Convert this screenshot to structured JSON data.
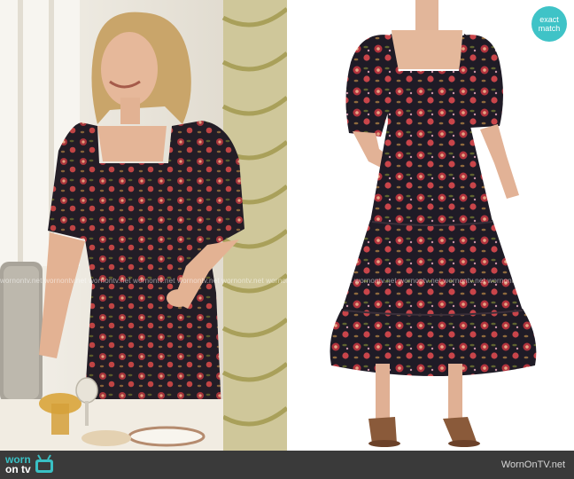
{
  "badge": {
    "line1": "exact",
    "line2": "match"
  },
  "watermark": {
    "text": "wornontv.net wornontv.net wornontv.net wornontv.net wornontv.net wornontv.net wornontv.net wornontv.net wornontv.net wornontv.net wornontv.net wornontv.net"
  },
  "footer": {
    "logo_line1": "worn",
    "logo_line2": "on tv",
    "site": "WornOnTV.net"
  },
  "colors": {
    "accent": "#3fc3c7",
    "dress_base": "#1f1b26",
    "floral_red": "#b2333d",
    "footer_bg": "#3a3a3a"
  },
  "icons": [
    "tv-icon"
  ]
}
